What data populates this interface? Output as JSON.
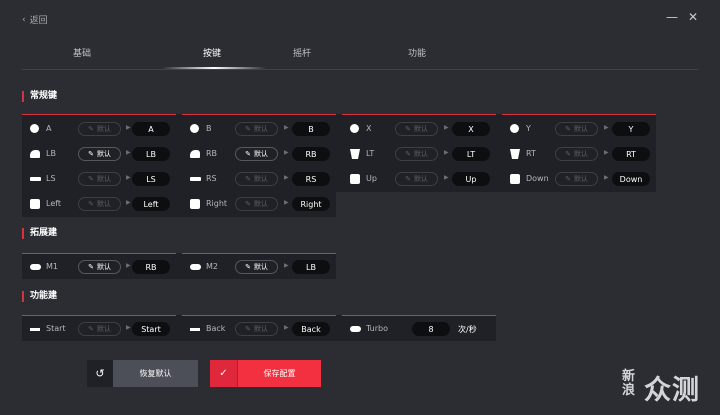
{
  "header": {
    "back_label": "返回",
    "back_icon": "chevron-left-icon",
    "minimize_icon": "minimize-icon",
    "close_icon": "close-icon"
  },
  "tabs": [
    {
      "label": "基础"
    },
    {
      "label": "按键"
    },
    {
      "label": "摇杆"
    },
    {
      "label": "功能"
    }
  ],
  "active_tab": "按键",
  "sections": {
    "regular": {
      "title": "常规键"
    },
    "extended": {
      "title": "拓展建"
    },
    "function": {
      "title": "功能建"
    }
  },
  "default_label": "默认",
  "regular_buttons": [
    {
      "name": "A",
      "value": "A",
      "icon": "circle-button-icon"
    },
    {
      "name": "B",
      "value": "B",
      "icon": "circle-button-icon"
    },
    {
      "name": "X",
      "value": "X",
      "icon": "circle-button-icon"
    },
    {
      "name": "Y",
      "value": "Y",
      "icon": "circle-button-icon"
    },
    {
      "name": "LB",
      "value": "LB",
      "icon": "bumper-icon"
    },
    {
      "name": "RB",
      "value": "RB",
      "icon": "bumper-icon"
    },
    {
      "name": "LT",
      "value": "LT",
      "icon": "trigger-icon"
    },
    {
      "name": "RT",
      "value": "RT",
      "icon": "trigger-icon"
    },
    {
      "name": "LS",
      "value": "LS",
      "icon": "stick-icon"
    },
    {
      "name": "RS",
      "value": "RS",
      "icon": "stick-icon"
    },
    {
      "name": "Up",
      "value": "Up",
      "icon": "dpad-icon"
    },
    {
      "name": "Down",
      "value": "Down",
      "icon": "dpad-icon"
    },
    {
      "name": "Left",
      "value": "Left",
      "icon": "dpad-icon"
    },
    {
      "name": "Right",
      "value": "Right",
      "icon": "dpad-icon"
    }
  ],
  "extended_buttons": [
    {
      "name": "M1",
      "value": "RB",
      "icon": "pill-button-icon"
    },
    {
      "name": "M2",
      "value": "LB",
      "icon": "pill-button-icon"
    }
  ],
  "function_buttons": [
    {
      "name": "Start",
      "value": "Start",
      "icon": "dash-button-icon"
    },
    {
      "name": "Back",
      "value": "Back",
      "icon": "dash-button-icon"
    },
    {
      "name": "Turbo",
      "value": "8",
      "suffix": "次/秒",
      "icon": "pill-button-icon"
    }
  ],
  "footer": {
    "reset_label": "恢复默认",
    "save_label": "保存配置",
    "reset_icon": "undo-icon",
    "save_icon": "check-icon"
  },
  "watermark": {
    "line1": "新浪",
    "line2": "众测"
  },
  "colors": {
    "accent": "#f2303f",
    "background": "#2b2d33",
    "panel": "#1f2126"
  }
}
